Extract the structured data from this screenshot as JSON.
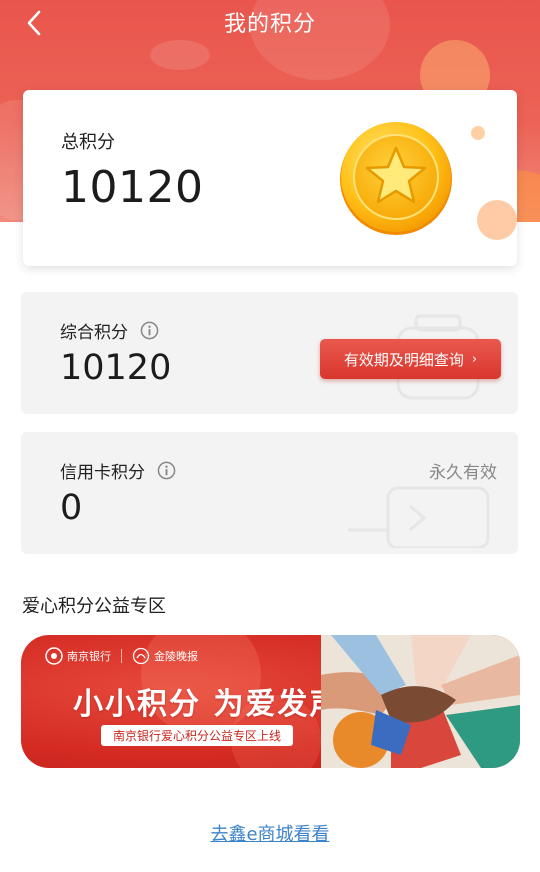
{
  "header": {
    "title": "我的积分",
    "back_icon": "chevron-left-icon",
    "bg_color": "#e9554c"
  },
  "total": {
    "label": "总积分",
    "value": "10120",
    "icon": "coin-star-icon"
  },
  "comprehensive": {
    "label": "综合积分",
    "value": "10120",
    "info_icon": "info-icon",
    "button_label": "有效期及明细查询",
    "button_chevron": "›",
    "button_color": "#e04a40"
  },
  "credit_card": {
    "label": "信用卡积分",
    "value": "0",
    "info_icon": "info-icon",
    "validity": "永久有效"
  },
  "charity": {
    "section_title": "爱心积分公益专区",
    "banner": {
      "brand_bank": "南京银行",
      "brand_partner": "金陵晚报",
      "headline": "小小积分 为爱发声",
      "subtitle": "南京银行爱心积分公益专区上线"
    }
  },
  "footer": {
    "mall_link": "去鑫e商城看看",
    "link_color": "#3d83c8"
  }
}
